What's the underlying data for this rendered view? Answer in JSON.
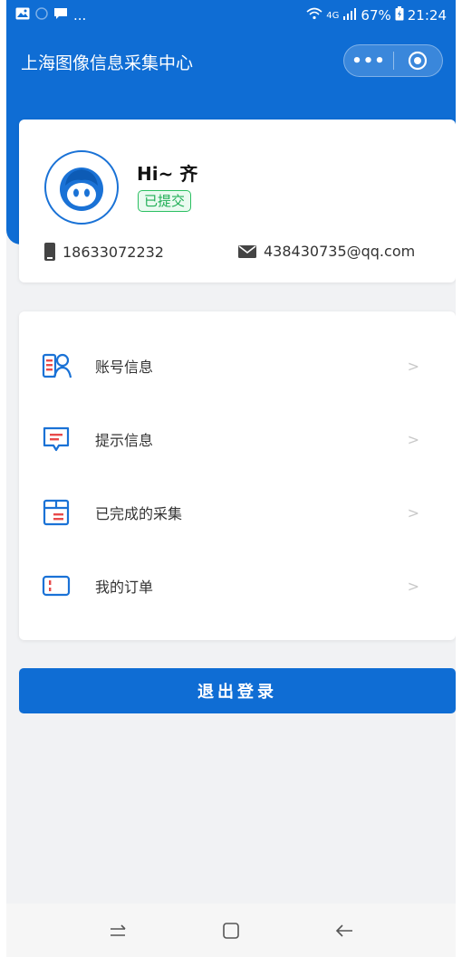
{
  "status_bar": {
    "battery": "67%",
    "time": "21:24",
    "network": "4G",
    "dots": "..."
  },
  "header": {
    "title": "上海图像信息采集中心",
    "capsule_more": "•••"
  },
  "profile": {
    "greeting": "Hi~ 齐",
    "status_badge": "已提交",
    "phone": "18633072232",
    "email": "438430735@qq.com"
  },
  "menu": {
    "items": [
      {
        "label": "账号信息",
        "icon": "account-icon"
      },
      {
        "label": "提示信息",
        "icon": "message-icon"
      },
      {
        "label": "已完成的采集",
        "icon": "box-icon"
      },
      {
        "label": "我的订单",
        "icon": "ticket-icon"
      }
    ],
    "chevron": ">"
  },
  "logout_label": "退出登录",
  "colors": {
    "primary": "#0f6dd4",
    "badge_green": "#1fae55",
    "icon_red": "#e84a4a",
    "icon_blue": "#1a72d6"
  }
}
